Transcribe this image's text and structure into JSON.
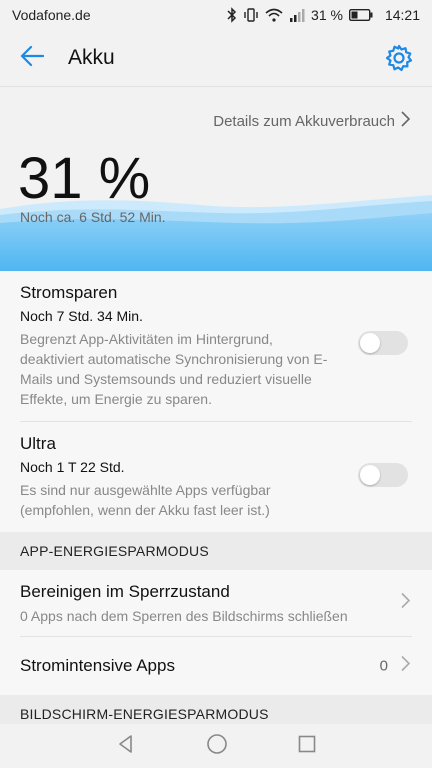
{
  "status": {
    "carrier": "Vodafone.de",
    "battery_percent": "31 %",
    "time": "14:21",
    "icons": [
      "bluetooth-icon",
      "vibrate-icon",
      "wifi-icon",
      "signal-icon",
      "battery-icon"
    ]
  },
  "header": {
    "title": "Akku",
    "back_icon": "back-arrow-icon",
    "settings_icon": "gear-icon"
  },
  "hero": {
    "details_link": "Details zum Akkuverbrauch",
    "percent": "31 %",
    "remaining": "Noch ca. 6 Std. 52 Min.",
    "level": 0.31
  },
  "power_saving": {
    "title": "Stromsparen",
    "subtitle": "Noch 7 Std. 34 Min.",
    "description": "Begrenzt App-Aktivitäten im Hintergrund, deaktiviert automatische Synchronisierung von E-Mails und Systemsounds und reduziert visuelle Effekte, um Energie zu sparen.",
    "enabled": false
  },
  "ultra": {
    "title": "Ultra",
    "subtitle": "Noch 1 T 22 Std.",
    "description": "Es sind nur ausgewählte Apps verfügbar (empfohlen, wenn der Akku fast leer ist.)",
    "enabled": false
  },
  "app_section": {
    "header": "APP-ENERGIESPARMODUS",
    "items": [
      {
        "title": "Bereinigen im Sperrzustand",
        "subtitle": "0 Apps nach dem Sperren des Bildschirms schließen"
      },
      {
        "title": "Stromintensive Apps",
        "count": "0"
      }
    ]
  },
  "screen_section": {
    "header": "BILDSCHIRM-ENERGIESPARMODUS"
  },
  "colors": {
    "accent": "#1e88e5",
    "wave_light": "#bfe3fb",
    "wave_dark": "#5bbcf3"
  }
}
